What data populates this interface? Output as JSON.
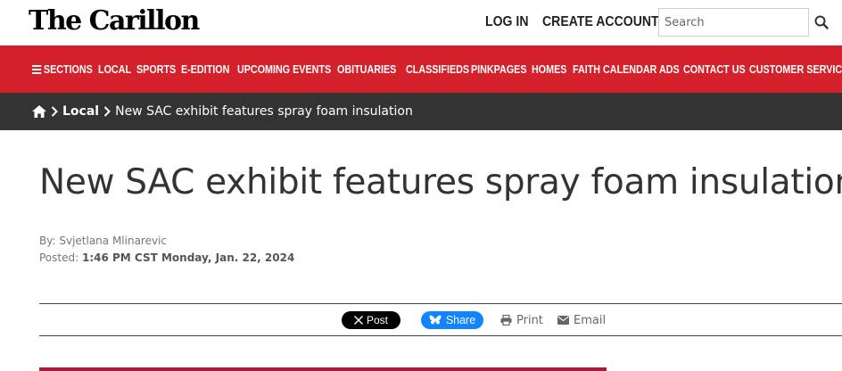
{
  "header": {
    "logo": "The Carillon",
    "login": "LOG IN",
    "create_account": "CREATE ACCOUNT",
    "search_placeholder": "Search"
  },
  "nav": {
    "sections": "SECTIONS",
    "items": [
      "LOCAL",
      "SPORTS",
      "E-EDITION",
      "UPCOMING EVENTS",
      "OBITUARIES",
      "CLASSIFIEDS",
      "PINKPAGES",
      "HOMES",
      "FAITH CALENDAR",
      "ADS",
      "CONTACT US",
      "CUSTOMER SERVICE"
    ]
  },
  "breadcrumb": {
    "section": "Local",
    "current": "New SAC exhibit features spray foam insulation"
  },
  "article": {
    "headline": "New SAC exhibit features spray foam insulation",
    "byline_prefix": "By:",
    "author": "Svjetlana Mlinarevic",
    "posted_prefix": "Posted:",
    "posted_time": "1:46 PM CST Monday, Jan. 22, 2024"
  },
  "share": {
    "x_label": "Post",
    "bluesky_label": "Share",
    "print_label": "Print",
    "email_label": "Email"
  },
  "colors": {
    "nav_red": "#d4212c",
    "breadcrumb_bg": "#333333",
    "bluesky_blue": "#1185fe",
    "accent": "#a81c3b"
  }
}
